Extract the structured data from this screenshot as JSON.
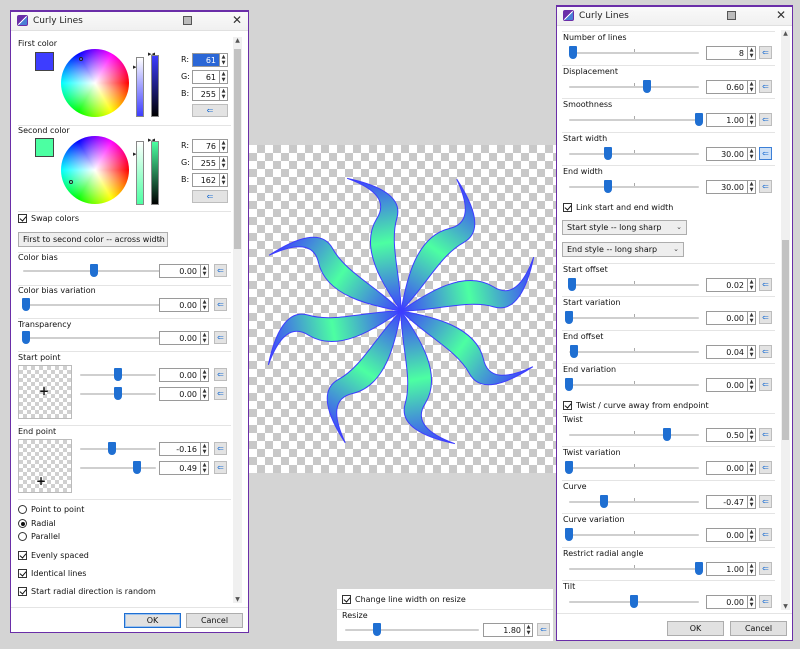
{
  "left_dialog": {
    "title": "Curly Lines",
    "first_color": {
      "label": "First color",
      "swatch": "#3d3dff",
      "r_label": "R:",
      "g_label": "G:",
      "b_label": "B:",
      "r": "61",
      "g": "61",
      "b": "255"
    },
    "second_color": {
      "label": "Second color",
      "swatch": "#4cffa2",
      "r_label": "R:",
      "g_label": "G:",
      "b_label": "B:",
      "r": "76",
      "g": "255",
      "b": "162"
    },
    "swap_colors": "Swap colors",
    "gradient_mode": "First to second color -- across width",
    "color_bias": {
      "label": "Color bias",
      "value": "0.00"
    },
    "color_bias_variation": {
      "label": "Color bias variation",
      "value": "0.00"
    },
    "transparency": {
      "label": "Transparency",
      "value": "0.00"
    },
    "start_point": {
      "label": "Start point",
      "x": "0.00",
      "y": "0.00"
    },
    "end_point": {
      "label": "End point",
      "x": "-0.16",
      "y": "0.49"
    },
    "mode_options": [
      "Point to point",
      "Radial",
      "Parallel"
    ],
    "mode_selected": "Radial",
    "evenly_spaced": "Evenly spaced",
    "identical_lines": "Identical lines",
    "start_radial_random": "Start radial direction is random",
    "ok": "OK",
    "cancel": "Cancel"
  },
  "right_dialog": {
    "title": "Curly Lines",
    "rows": [
      {
        "label": "Number of lines",
        "value": "8",
        "level": 0.03
      },
      {
        "label": "Displacement",
        "value": "0.60",
        "level": 0.6
      },
      {
        "label": "Smoothness",
        "value": "1.00",
        "level": 1.0
      },
      {
        "label": "Start width",
        "value": "30.00",
        "level": 0.3
      },
      {
        "label": "End width",
        "value": "30.00",
        "level": 0.3
      }
    ],
    "link_widths": "Link start and end width",
    "start_style": "Start style -- long sharp",
    "end_style": "End style -- long sharp",
    "rows2": [
      {
        "label": "Start offset",
        "value": "0.02",
        "level": 0.02
      },
      {
        "label": "Start variation",
        "value": "0.00",
        "level": 0.0
      },
      {
        "label": "End offset",
        "value": "0.04",
        "level": 0.04
      },
      {
        "label": "End variation",
        "value": "0.00",
        "level": 0.0
      }
    ],
    "twist_curve": "Twist / curve away from endpoint",
    "rows3": [
      {
        "label": "Twist",
        "value": "0.50",
        "level": 0.75
      },
      {
        "label": "Twist variation",
        "value": "0.00",
        "level": 0.0
      },
      {
        "label": "Curve",
        "value": "-0.47",
        "level": 0.27
      },
      {
        "label": "Curve variation",
        "value": "0.00",
        "level": 0.0
      },
      {
        "label": "Restrict radial angle",
        "value": "1.00",
        "level": 1.0
      },
      {
        "label": "Tilt",
        "value": "0.00",
        "level": 0.5
      }
    ],
    "ok": "OK",
    "cancel": "Cancel"
  },
  "resize_panel": {
    "change_width": "Change line width on resize",
    "resize_label": "Resize",
    "value": "1.80",
    "level": 0.24
  },
  "colors": {
    "accent": "#1f6fd2",
    "window_border": "#6a2ea8",
    "line_blue": "#3d3dff",
    "line_green": "#4cffa2"
  }
}
